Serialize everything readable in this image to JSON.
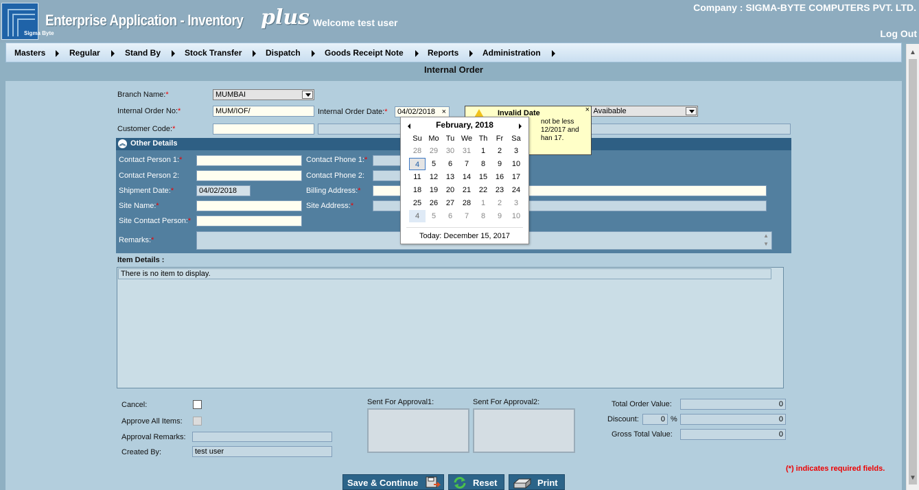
{
  "header": {
    "logo_text": "Sigma Byte",
    "app_title": "Enterprise Application - Inventory",
    "app_plus": "plus",
    "welcome": "Welcome test user",
    "company": "Company : SIGMA-BYTE COMPUTERS PVT. LTD.",
    "logout": "Log Out"
  },
  "menu": [
    "Masters",
    "Regular",
    "Stand By",
    "Stock Transfer",
    "Dispatch",
    "Goods Receipt Note",
    "Reports",
    "Administration"
  ],
  "page_title": "Internal Order",
  "form": {
    "branch_label": "Branch Name:",
    "branch_value": "MUMBAI",
    "io_no_label": "Internal Order No:",
    "io_no_value": "MUM/IOF/",
    "io_date_label": "Internal Order Date:",
    "io_date_value": "04/02/2018",
    "io_date_clear": "×",
    "status_value": "t Avaibable",
    "customer_code_label": "Customer Code:",
    "required_mark": "*"
  },
  "other_details": {
    "title": "Other Details",
    "contact_person1_label": "Contact Person 1:",
    "contact_person2_label": "Contact Person 2:",
    "shipment_date_label": "Shipment Date:",
    "shipment_date_value": "04/02/2018",
    "site_name_label": "Site Name:",
    "site_contact_label": "Site Contact Person:",
    "remarks_label": "Remarks:",
    "contact_phone1_label": "Contact Phone 1:",
    "contact_phone2_label": "Contact Phone 2:",
    "billing_address_label": "Billing Address:",
    "site_address_label": "Site Address:"
  },
  "items": {
    "title": "Item Details :",
    "empty_text": "There is no item to display."
  },
  "footer": {
    "cancel_label": "Cancel:",
    "approve_all_label": "Approve All Items:",
    "approval_remarks_label": "Approval Remarks:",
    "created_by_label": "Created By:",
    "created_by_value": "test user",
    "sent_approval1_label": "Sent For Approval1:",
    "sent_approval2_label": "Sent For Approval2:",
    "total_order_label": "Total Order Value:",
    "total_order_value": "0",
    "discount_label": "Discount:",
    "discount_pct": "0",
    "discount_pct_sign": "%",
    "discount_value": "0",
    "gross_total_label": "Gross Total Value:",
    "gross_total_value": "0",
    "required_note": "(*) indicates required fields."
  },
  "buttons": {
    "save": "Save & Continue",
    "reset": "Reset",
    "print": "Print"
  },
  "tooltip": {
    "title": "Invalid Date",
    "text": "not be less 12/2017 and han 17.",
    "close": "×"
  },
  "calendar": {
    "title": "February, 2018",
    "dow": [
      "Su",
      "Mo",
      "Tu",
      "We",
      "Th",
      "Fr",
      "Sa"
    ],
    "weeks": [
      [
        "28",
        "29",
        "30",
        "31",
        "1",
        "2",
        "3"
      ],
      [
        "4",
        "5",
        "6",
        "7",
        "8",
        "9",
        "10"
      ],
      [
        "11",
        "12",
        "13",
        "14",
        "15",
        "16",
        "17"
      ],
      [
        "18",
        "19",
        "20",
        "21",
        "22",
        "23",
        "24"
      ],
      [
        "25",
        "26",
        "27",
        "28",
        "1",
        "2",
        "3"
      ],
      [
        "4",
        "5",
        "6",
        "7",
        "8",
        "9",
        "10"
      ]
    ],
    "today": "Today: December 15, 2017"
  },
  "colors": {
    "header_bg": "#8eacbf",
    "panel_bg": "#b3cedd",
    "section_header": "#2e5f84",
    "section_body": "#527f9f",
    "button_bg": "#2c6489",
    "required": "#ee0000",
    "tooltip_bg": "#ffffc8"
  },
  "icons": [
    "collapse-up-icon",
    "warning-icon",
    "save-disk-icon",
    "reset-arrows-icon",
    "printer-icon",
    "chevron-down-icon",
    "arrow-left-icon",
    "arrow-right-icon"
  ]
}
